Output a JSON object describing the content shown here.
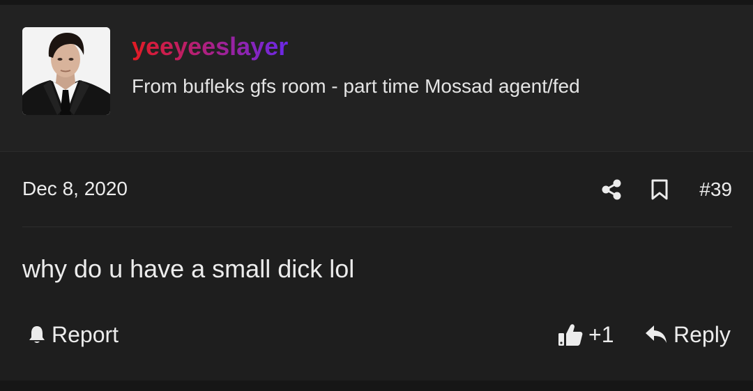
{
  "user": {
    "username": "yeeyeeslayer",
    "title": "From bufleks gfs room - part time Mossad agent/fed",
    "avatar": "user-avatar-photo"
  },
  "post": {
    "date": "Dec 8, 2020",
    "number": "#39",
    "message": "why do u have a small dick lol"
  },
  "actions": {
    "report_label": "Report",
    "like_count": "+1",
    "reply_label": "Reply"
  },
  "icons": {
    "share": "share-icon",
    "bookmark": "bookmark-icon",
    "report": "bell-icon",
    "like": "thumbs-up-icon",
    "reply": "reply-arrow-icon"
  },
  "colors": {
    "username_gradient": [
      "#e31b23",
      "#b0207c",
      "#6a28e8"
    ],
    "background": "#1e1e1e",
    "header_background": "#222222",
    "text": "#ececec"
  }
}
